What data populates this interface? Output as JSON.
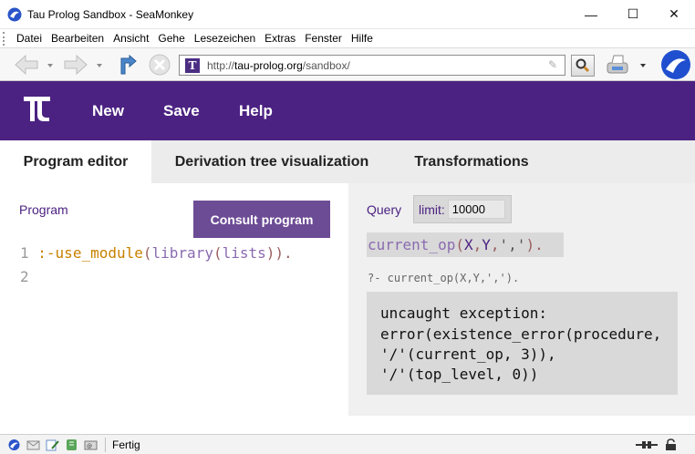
{
  "window": {
    "title": "Tau Prolog Sandbox - SeaMonkey",
    "minimize_glyph": "—",
    "maximize_glyph": "☐",
    "close_glyph": "✕"
  },
  "menu": [
    "Datei",
    "Bearbeiten",
    "Ansicht",
    "Gehe",
    "Lesezeichen",
    "Extras",
    "Fenster",
    "Hilfe"
  ],
  "navbar": {
    "url_prefix": "http://",
    "url_host": "tau-prolog.org",
    "url_path": "/sandbox/",
    "icons": [
      "back-arrow-icon",
      "forward-arrow-icon",
      "reload-icon",
      "stop-icon",
      "search-icon",
      "print-icon",
      "seamonkey-icon"
    ]
  },
  "header": {
    "logo_glyph": "T",
    "nav": [
      "New",
      "Save",
      "Help"
    ],
    "brand_color": "#4b2282"
  },
  "tabs": [
    {
      "label": "Program editor",
      "active": true
    },
    {
      "label": "Derivation tree visualization",
      "active": false
    },
    {
      "label": "Transformations",
      "active": false
    }
  ],
  "program": {
    "label": "Program",
    "consult_button": "Consult program",
    "lines": [
      {
        "no": "1",
        "directive": ":-",
        "pred": "use_module",
        "p1": "(",
        "pred2": "library",
        "p2": "(",
        "pred3": "lists",
        "p3": ")).",
        "p4": ""
      },
      {
        "no": "2"
      }
    ]
  },
  "query": {
    "label": "Query",
    "limit_label": "limit:",
    "limit_value": "10000",
    "pred": "current_op",
    "open": "(",
    "var_x": "X",
    "comma1": ",",
    "var_y": "Y",
    "comma2": ",",
    "str": "','",
    "close": ").",
    "echo": "?- current_op(X,Y,',')."
  },
  "output": {
    "lines": [
      "uncaught exception:",
      "error(existence_error(procedure,",
      "'/'(current_op, 3)),",
      "'/'(top_level, 0))"
    ]
  },
  "status": {
    "text": "Fertig"
  }
}
